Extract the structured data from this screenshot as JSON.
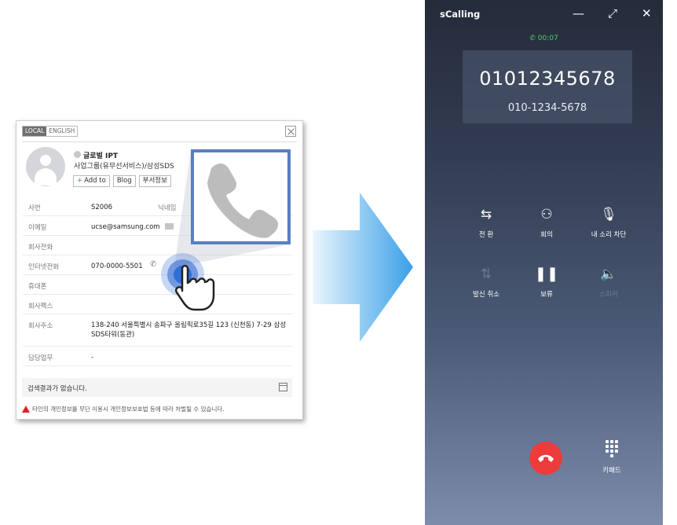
{
  "card": {
    "lang_local": "LOCAL",
    "lang_english": "ENGLISH",
    "name": "글로벌 IPT",
    "org": "사업그룹(유무선서비스)/삼성SDS",
    "buttons": {
      "add_to": "Add to",
      "blog": "Blog",
      "dept_info": "부서정보"
    },
    "rows": [
      {
        "label": "사번",
        "value": "S2006",
        "extra": "닉네임"
      },
      {
        "label": "이메일",
        "value": "ucse@samsung.com"
      },
      {
        "label": "회사전화",
        "value": ""
      },
      {
        "label": "인터넷전화",
        "value": "070-0000-5501"
      },
      {
        "label": "휴대폰",
        "value": ""
      },
      {
        "label": "회사팩스",
        "value": ""
      },
      {
        "label": "회사주소",
        "value": "138-240 서울특별시 송파구 올림픽로35길 123 (신천동) 7-29 삼성SDS타워(동관)"
      },
      {
        "label": "담당업무",
        "value": "-"
      }
    ],
    "no_results": "검색결과가 없습니다.",
    "warning": "타인의 개인정보를 무단 이용시 개인정보보호법 등에 따라 처벌될 수 있습니다."
  },
  "call": {
    "app_title": "sCalling",
    "timer": "00:07",
    "number": "01012345678",
    "number_formatted": "010-1234-5678",
    "actions": [
      {
        "label": "전 환",
        "icon": "transfer-call-icon",
        "enabled": true
      },
      {
        "label": "회의",
        "icon": "conference-icon",
        "enabled": true
      },
      {
        "label": "내 소리 차단",
        "icon": "mute-mic-icon",
        "enabled": true
      },
      {
        "label": "발신 취소",
        "icon": "cancel-transfer-icon",
        "enabled": true
      },
      {
        "label": "보류",
        "icon": "hold-pause-icon",
        "enabled": true
      },
      {
        "label": "스피커",
        "icon": "speaker-icon",
        "enabled": false
      }
    ],
    "keypad_label": "키패드",
    "colors": {
      "end_call": "#ee3b3b",
      "timer": "#4cd06a",
      "arrow": "#3aa0e8",
      "callout_border": "#5a7fc1"
    }
  }
}
